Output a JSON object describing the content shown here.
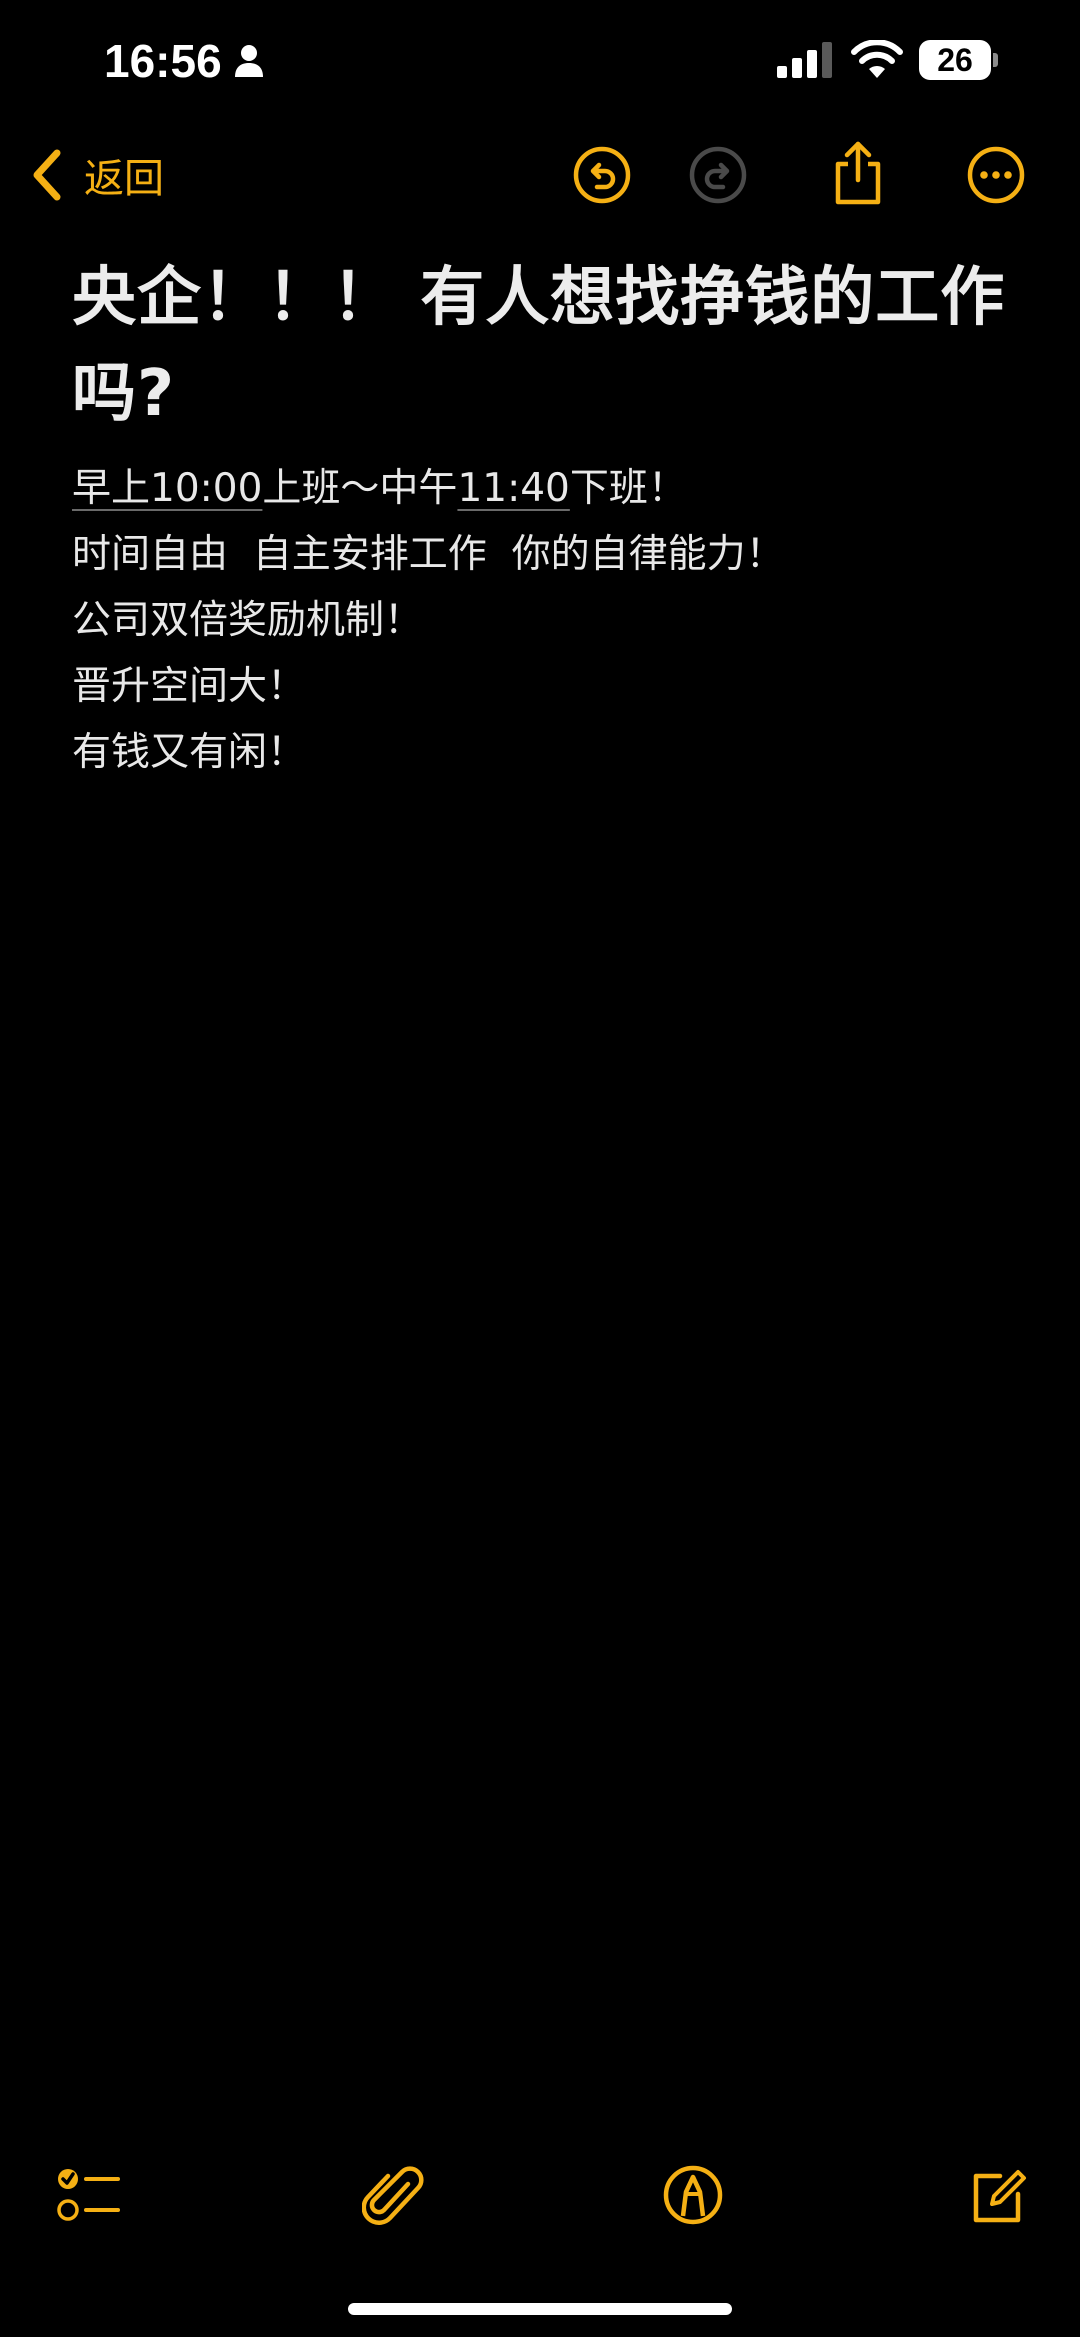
{
  "status_bar": {
    "time": "16:56",
    "battery_level": "26",
    "icons": [
      "person-icon",
      "cellular-signal-icon",
      "wifi-icon",
      "battery-icon"
    ]
  },
  "nav": {
    "back_label": "返回",
    "icons": [
      "chevron-left-icon",
      "undo-icon",
      "redo-icon",
      "share-icon",
      "more-icon"
    ]
  },
  "note": {
    "title": "央企！！！ 有人想找挣钱的工作吗?",
    "lines": [
      {
        "segments": [
          "早上",
          "10:00",
          "上班～中午",
          "11:40",
          "下班！"
        ],
        "underlined": [
          0,
          1,
          3
        ]
      },
      {
        "text": "时间自由  自主安排工作  你的自律能力！"
      },
      {
        "text": "公司双倍奖励机制！"
      },
      {
        "text": "晋升空间大！"
      },
      {
        "text": "有钱又有闲！"
      }
    ]
  },
  "toolbar": {
    "icons": [
      "checklist-icon",
      "paperclip-icon",
      "markup-pen-icon",
      "compose-icon"
    ]
  },
  "colors": {
    "accent": "#f5b014",
    "disabled_icon": "#4a4a4a",
    "background": "#000000",
    "text": "#e8e8e8"
  }
}
